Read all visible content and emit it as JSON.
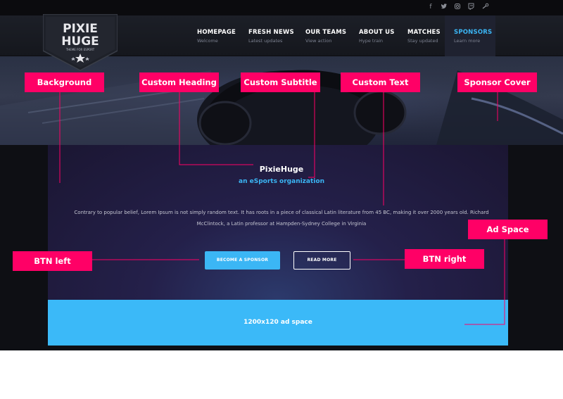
{
  "logo": {
    "line1": "PIXIE",
    "line2": "HUGE",
    "tagline": "THEME FOR ESPORT"
  },
  "social_icons": [
    "facebook-icon",
    "twitter-icon",
    "instagram-icon",
    "twitch-icon",
    "steam-icon"
  ],
  "nav": [
    {
      "label": "HOMEPAGE",
      "sub": "Welcome"
    },
    {
      "label": "FRESH NEWS",
      "sub": "Latest updates"
    },
    {
      "label": "OUR TEAMS",
      "sub": "View action"
    },
    {
      "label": "ABOUT US",
      "sub": "Hype train"
    },
    {
      "label": "MATCHES",
      "sub": "Stay updated"
    },
    {
      "label": "SPONSORS",
      "sub": "Learn more",
      "active": true
    }
  ],
  "hero": {
    "heading": "PixieHuge",
    "subtitle": "an eSports organization",
    "text": "Contrary to popular belief, Lorem Ipsum is not simply random text. It has roots in a piece of classical Latin literature from 45 BC, making it over 2000 years old. Richard McClintock, a Latin professor at Hampden-Sydney College in Virginia"
  },
  "buttons": {
    "left": "BECOME A SPONSOR",
    "right": "READ MORE"
  },
  "ad": {
    "label": "1200x120 ad space"
  },
  "callouts": {
    "background": "Background",
    "custom_heading": "Custom Heading",
    "custom_subtitle": "Custom Subtitle",
    "custom_text": "Custom Text",
    "sponsor_cover": "Sponsor Cover",
    "ad_space": "Ad Space",
    "btn_left": "BTN left",
    "btn_right": "BTN right"
  },
  "colors": {
    "accent": "#3bb6f5",
    "callout": "#ff0066",
    "ad_bg": "#3bb9f8",
    "panel": "#24204a"
  }
}
